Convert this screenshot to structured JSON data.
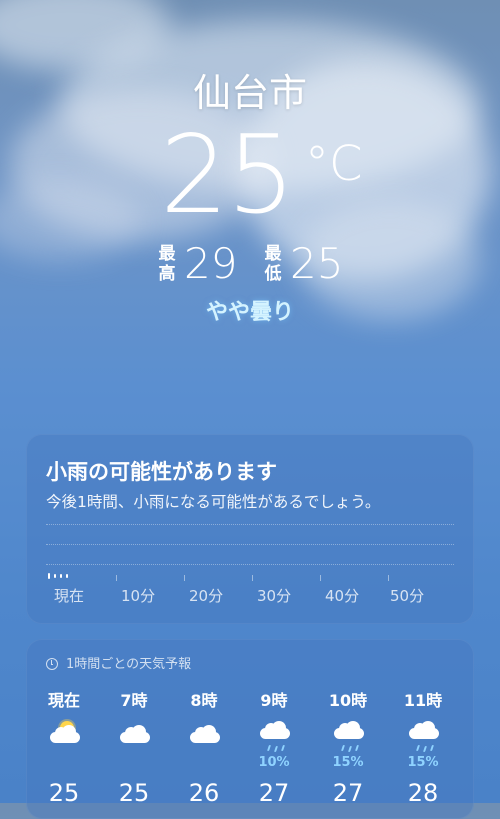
{
  "city": "仙台市",
  "current": {
    "temp": "25",
    "unit": "°C",
    "high_label": "最高",
    "high": "29",
    "low_label": "最低",
    "low": "25",
    "condition": "やや曇り"
  },
  "rain_card": {
    "title": "小雨の可能性があります",
    "subtitle": "今後1時間、小雨になる可能性があるでしょう。",
    "time_labels": [
      "現在",
      "10分",
      "20分",
      "30分",
      "40分",
      "50分"
    ]
  },
  "hourly_card": {
    "header": "1時間ごとの天気予報",
    "hours": [
      {
        "label": "現在",
        "icon": "partly-cloudy-day-icon",
        "precip": "",
        "temp": "25"
      },
      {
        "label": "7時",
        "icon": "cloud-icon",
        "precip": "",
        "temp": "25"
      },
      {
        "label": "8時",
        "icon": "cloud-icon",
        "precip": "",
        "temp": "26"
      },
      {
        "label": "9時",
        "icon": "cloud-rain-icon",
        "precip": "10%",
        "temp": "27"
      },
      {
        "label": "10時",
        "icon": "cloud-rain-icon",
        "precip": "15%",
        "temp": "27"
      },
      {
        "label": "11時",
        "icon": "cloud-rain-icon",
        "precip": "15%",
        "temp": "28"
      }
    ]
  },
  "colors": {
    "sky": "#5b8fd0",
    "card": "#4678be",
    "precip": "#8fd3ff",
    "sun": "#ffd54a",
    "condition": "#d4f3ff"
  }
}
